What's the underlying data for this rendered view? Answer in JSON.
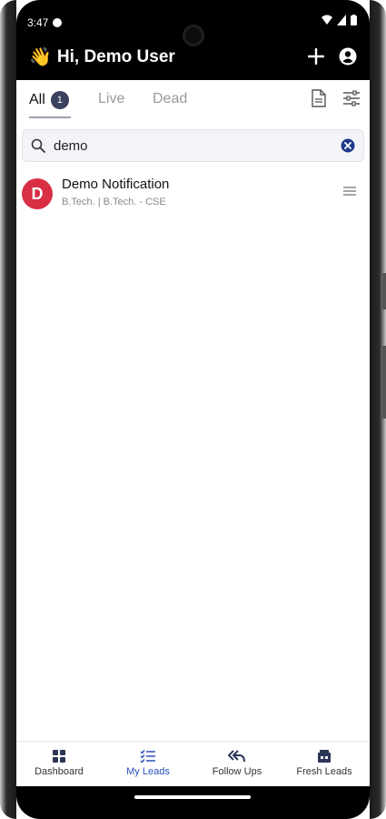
{
  "status_bar": {
    "time": "3:47"
  },
  "header": {
    "greeting": "Hi, Demo User",
    "wave_emoji": "👋"
  },
  "tabs": [
    {
      "label": "All",
      "badge": "1",
      "active": true
    },
    {
      "label": "Live",
      "active": false
    },
    {
      "label": "Dead",
      "active": false
    }
  ],
  "search": {
    "value": "demo",
    "placeholder": ""
  },
  "leads": [
    {
      "initial": "D",
      "name": "Demo Notification",
      "details": "B.Tech. | B.Tech. - CSE",
      "avatar_color": "#d92f45"
    }
  ],
  "bottom_nav": [
    {
      "label": "Dashboard",
      "icon": "grid-icon",
      "active": false
    },
    {
      "label": "My Leads",
      "icon": "checklist-icon",
      "active": true
    },
    {
      "label": "Follow Ups",
      "icon": "reply-all-icon",
      "active": false
    },
    {
      "label": "Fresh Leads",
      "icon": "store-icon",
      "active": false
    }
  ],
  "colors": {
    "accent": "#2b4fbf",
    "badge": "#3a4060",
    "header_bg": "#000000"
  }
}
